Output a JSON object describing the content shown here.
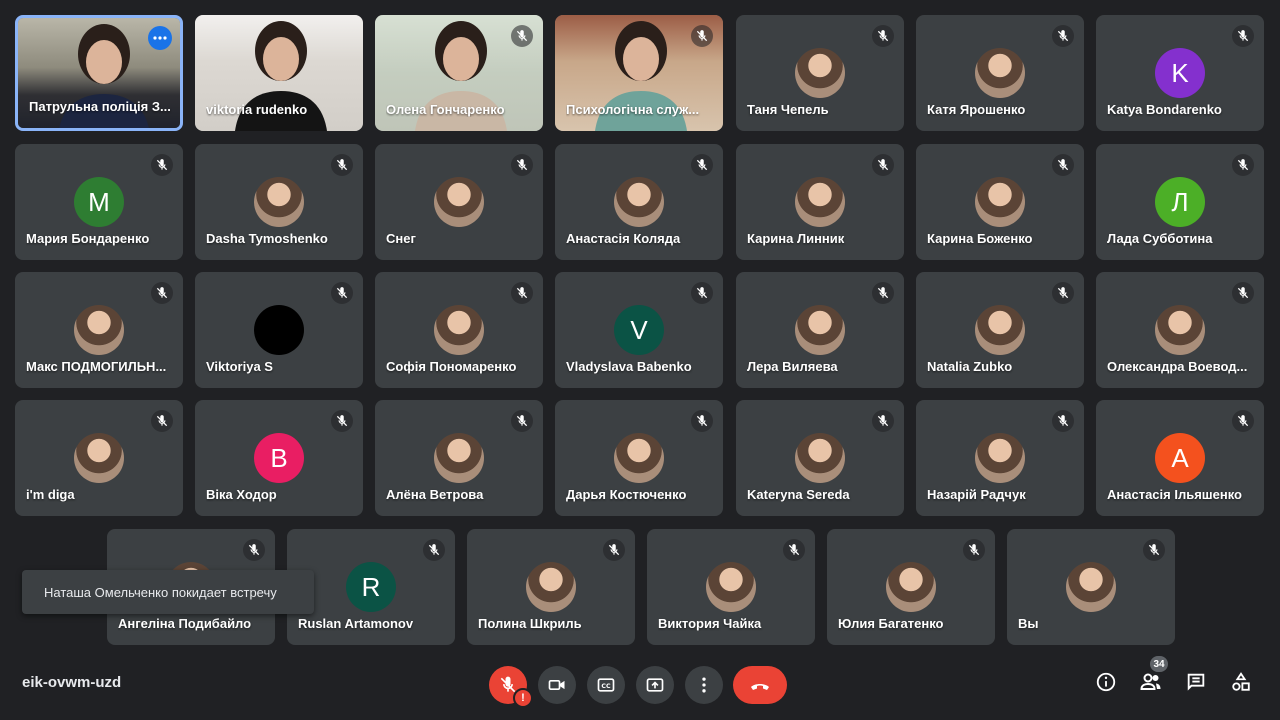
{
  "colors": {
    "background": "#202124",
    "tile": "#3c4043",
    "active_border": "#8ab4f8",
    "danger": "#ea4335",
    "accent": "#1a73e8"
  },
  "participants": [
    {
      "name": "Патрульна поліція З...",
      "kind": "video",
      "active": true,
      "icon": "more-options-icon"
    },
    {
      "name": "viktoria rudenko",
      "kind": "video"
    },
    {
      "name": "Олена Гончаренко",
      "kind": "video",
      "muted": true
    },
    {
      "name": "Психологічна служ...",
      "kind": "video",
      "muted": true
    },
    {
      "name": "Таня Чепель",
      "kind": "photo",
      "muted": true
    },
    {
      "name": "Катя Ярошенко",
      "kind": "photo",
      "muted": true
    },
    {
      "name": "Katya Bondarenko",
      "kind": "letter",
      "letter": "K",
      "color": "#8430ce",
      "muted": true
    },
    {
      "name": "Мария Бондаренко",
      "kind": "letter",
      "letter": "M",
      "color": "#2e7d32",
      "muted": true
    },
    {
      "name": "Dasha Tymoshenko",
      "kind": "photo",
      "muted": true
    },
    {
      "name": "Снег",
      "kind": "photo",
      "muted": true
    },
    {
      "name": "Анастасія Коляда",
      "kind": "photo",
      "muted": true
    },
    {
      "name": "Карина Линник",
      "kind": "photo",
      "muted": true
    },
    {
      "name": "Карина Боженко",
      "kind": "photo",
      "muted": true
    },
    {
      "name": "Лада Субботина",
      "kind": "letter",
      "letter": "Л",
      "color": "#4caf27",
      "muted": true
    },
    {
      "name": "Макс ПОДМОГИЛЬН...",
      "kind": "photo",
      "muted": true
    },
    {
      "name": "Viktoriya S",
      "kind": "letter",
      "letter": "",
      "color": "#000000",
      "muted": true
    },
    {
      "name": "Софія Пономаренко",
      "kind": "photo",
      "muted": true
    },
    {
      "name": "Vladyslava Babenko",
      "kind": "letter",
      "letter": "V",
      "color": "#0b5345",
      "muted": true
    },
    {
      "name": "Лера Виляева",
      "kind": "photo",
      "muted": true
    },
    {
      "name": "Natalia Zubko",
      "kind": "photo",
      "muted": true
    },
    {
      "name": "Олександра Воевод...",
      "kind": "photo",
      "muted": true
    },
    {
      "name": "i'm diga",
      "kind": "photo",
      "muted": true
    },
    {
      "name": "Віка Ходор",
      "kind": "letter",
      "letter": "B",
      "color": "#e91e63",
      "muted": true
    },
    {
      "name": "Алёна Ветрова",
      "kind": "photo",
      "muted": true
    },
    {
      "name": "Дарья Костюченко",
      "kind": "photo",
      "muted": true
    },
    {
      "name": "Kateryna Sereda",
      "kind": "photo",
      "muted": true
    },
    {
      "name": "Назарій Радчук",
      "kind": "photo",
      "muted": true
    },
    {
      "name": "Анастасія Ільяшенко",
      "kind": "letter",
      "letter": "A",
      "color": "#f4511e",
      "muted": true
    },
    {
      "name": "Ангеліна Подибайло",
      "kind": "photo",
      "muted": true
    },
    {
      "name": "Ruslan Artamonov",
      "kind": "letter",
      "letter": "R",
      "color": "#0b5345",
      "muted": true
    },
    {
      "name": "Полина Шкриль",
      "kind": "photo",
      "muted": true
    },
    {
      "name": "Виктория Чайка",
      "kind": "photo",
      "muted": true
    },
    {
      "name": "Юлия Багатенко",
      "kind": "photo",
      "muted": true
    },
    {
      "name": "Вы",
      "kind": "photo",
      "muted": true
    }
  ],
  "toast": "Наташа Омельченко покидает встречу",
  "meeting_code": "eik-ovwm-uzd",
  "controls": [
    {
      "id": "mic",
      "icon": "mic-off-icon",
      "state": "red"
    },
    {
      "id": "camera",
      "icon": "video-camera-icon"
    },
    {
      "id": "captions",
      "icon": "captions-icon"
    },
    {
      "id": "present",
      "icon": "present-screen-icon"
    },
    {
      "id": "more",
      "icon": "more-vert-icon"
    },
    {
      "id": "hangup",
      "icon": "hang-up-icon"
    }
  ],
  "right_controls": {
    "info_icon": "info-icon",
    "people_icon": "people-icon",
    "people_count": "34",
    "chat_icon": "chat-icon",
    "activities_icon": "activities-icon"
  }
}
